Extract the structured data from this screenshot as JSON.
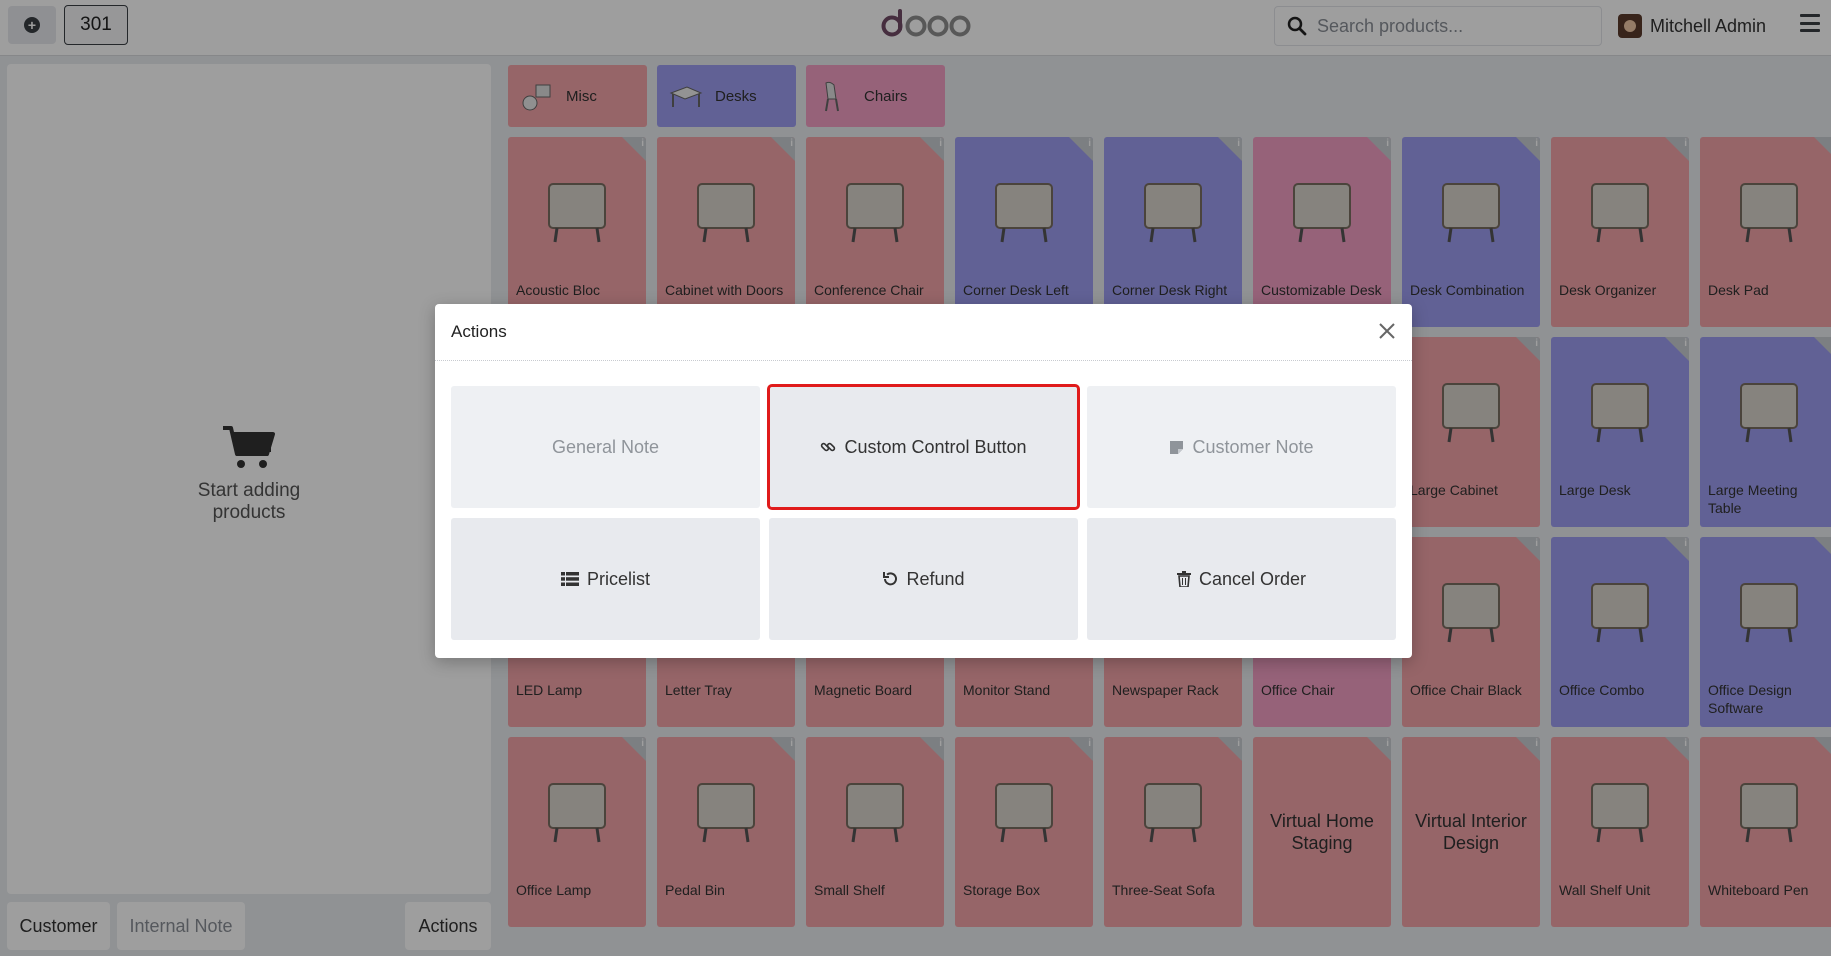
{
  "topbar": {
    "order_number": "301",
    "search_placeholder": "Search products...",
    "user_name": "Mitchell Admin",
    "logo": "odoo"
  },
  "left": {
    "empty_line1": "Start adding",
    "empty_line2": "products",
    "customer": "Customer",
    "internal_note": "Internal Note",
    "actions": "Actions"
  },
  "categories": [
    {
      "label": "Misc",
      "color": "#f2a3a8"
    },
    {
      "label": "Desks",
      "color": "#9d9df0"
    },
    {
      "label": "Chairs",
      "color": "#f39fc4"
    }
  ],
  "products": {
    "r1": [
      "Acoustic Bloc",
      "Cabinet with Doors",
      "Conference Chair",
      "Corner Desk Left",
      "Corner Desk Right",
      "Customizable Desk",
      "Desk Combination",
      "Desk Organizer",
      "Desk Pad"
    ],
    "r2": [
      "Large Cabinet",
      "Large Desk",
      "Large Meeting Table"
    ],
    "r3": [
      "LED Lamp",
      "Letter Tray",
      "Magnetic Board",
      "Monitor Stand",
      "Newspaper Rack",
      "Office Chair",
      "Office Chair Black",
      "Office Combo",
      "Office Design Software"
    ],
    "r4": [
      "Office Lamp",
      "Pedal Bin",
      "Small Shelf",
      "Storage Box",
      "Three-Seat Sofa",
      "Virtual Home Staging",
      "Virtual Interior Design",
      "Wall Shelf Unit",
      "Whiteboard Pen"
    ]
  },
  "modal": {
    "title": "Actions",
    "buttons": {
      "general_note": "General Note",
      "custom_control": "Custom Control Button",
      "customer_note": "Customer Note",
      "pricelist": "Pricelist",
      "refund": "Refund",
      "cancel_order": "Cancel Order"
    }
  },
  "colors": {
    "highlight": "#e01b1b",
    "misc": "#f2a3a8",
    "desks": "#9d9df0",
    "chairs": "#f39fc4"
  }
}
